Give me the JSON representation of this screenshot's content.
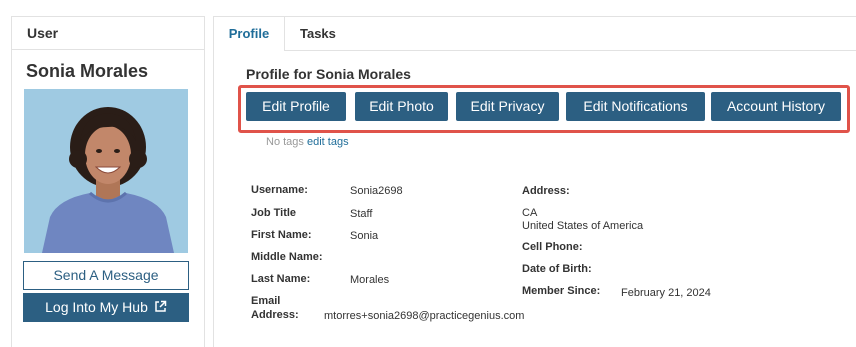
{
  "sidebar": {
    "header": "User",
    "user_name": "Sonia Morales",
    "send_message": "Send A Message",
    "log_into_hub": "Log Into My Hub"
  },
  "tabs": [
    "Profile",
    "Tasks"
  ],
  "profile": {
    "title": "Profile for Sonia  Morales",
    "actions": [
      "Edit Profile",
      "Edit Photo",
      "Edit Privacy",
      "Edit Notifications",
      "Account History"
    ],
    "no_tags": "No tags",
    "edit_tags": "edit tags"
  },
  "fields": {
    "username_label": "Username:",
    "username_value": "Sonia2698",
    "job_title_label": "Job Title",
    "job_title_value": "Staff",
    "first_name_label": "First Name:",
    "first_name_value": "Sonia",
    "middle_name_label": "Middle Name:",
    "last_name_label": "Last Name:",
    "last_name_value": "Morales",
    "email_label_1": "Email",
    "email_label_2": "Address:",
    "email_value": "mtorres+sonia2698@practicegenius.com",
    "address_label": "Address:",
    "address_line1": "CA",
    "address_line2": "United States of America",
    "cell_phone_label": "Cell Phone:",
    "dob_label": "Date of Birth:",
    "member_since_label": "Member Since:",
    "member_since_value": "February 21, 2024"
  },
  "colors": {
    "primary": "#2c5f82",
    "highlight_border": "#e0534a",
    "tab_active": "#1f6d99"
  }
}
